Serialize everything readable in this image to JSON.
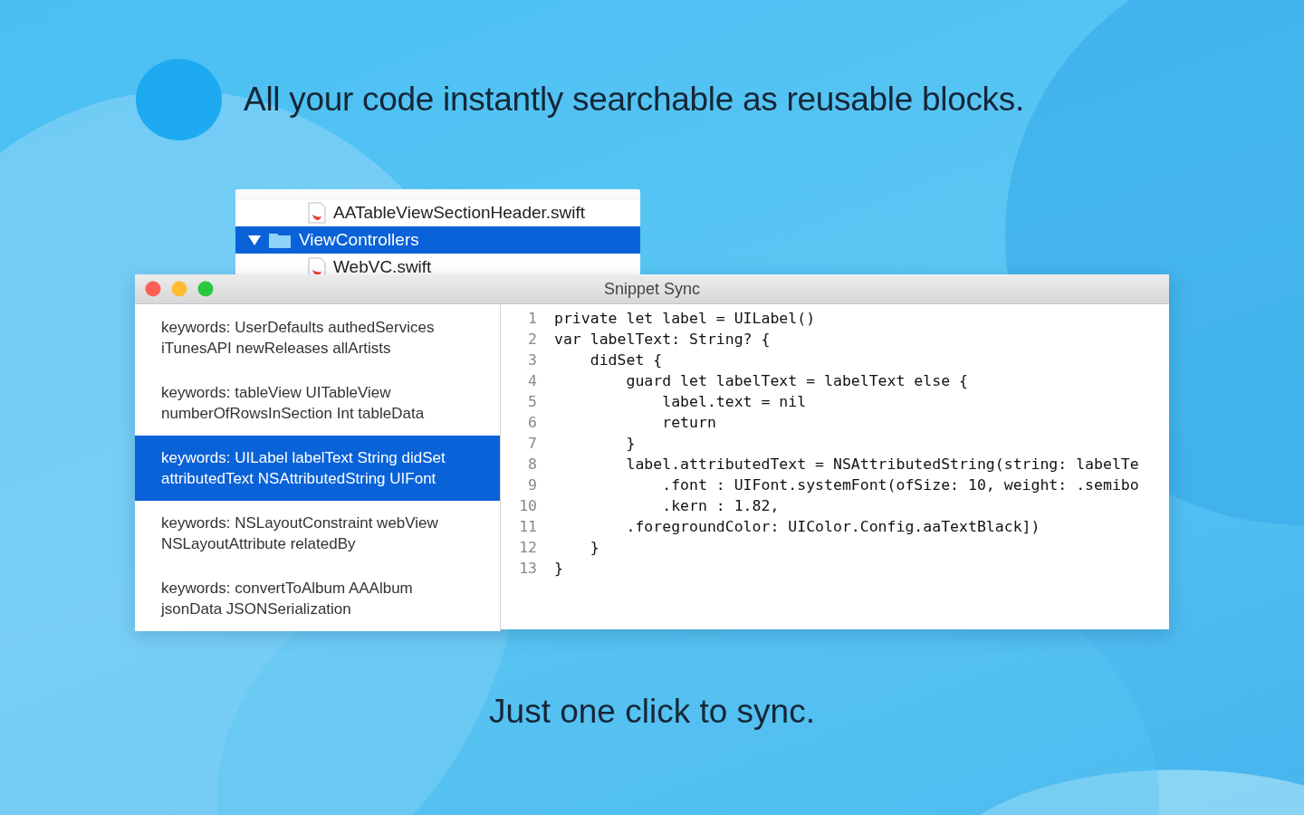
{
  "headline": "All your code instantly searchable as reusable blocks.",
  "file_tree": {
    "rows": [
      {
        "name": "AATableViewSectionHeader.swift",
        "kind": "file",
        "selected": false
      },
      {
        "name": "ViewControllers",
        "kind": "folder",
        "expanded": true,
        "selected": true
      },
      {
        "name": "WebVC.swift",
        "kind": "file",
        "selected": false
      }
    ]
  },
  "window": {
    "title": "Snippet Sync",
    "snippets": [
      {
        "text": "keywords: UserDefaults authedServices\niTunesAPI newReleases allArtists",
        "selected": false
      },
      {
        "text": "keywords: tableView UITableView\nnumberOfRowsInSection Int tableData",
        "selected": false
      },
      {
        "text": "keywords: UILabel labelText String didSet\nattributedText NSAttributedString UIFont",
        "selected": true
      },
      {
        "text": "keywords: NSLayoutConstraint webView\nNSLayoutAttribute relatedBy",
        "selected": false
      },
      {
        "text": "keywords: convertToAlbum AAAlbum\njsonData JSONSerialization",
        "selected": false
      }
    ],
    "code": [
      {
        "number": "1",
        "text": "private let label = UILabel()"
      },
      {
        "number": "2",
        "text": "var labelText: String? {"
      },
      {
        "number": "3",
        "text": "    didSet {"
      },
      {
        "number": "4",
        "text": "        guard let labelText = labelText else {"
      },
      {
        "number": "5",
        "text": "            label.text = nil"
      },
      {
        "number": "6",
        "text": "            return"
      },
      {
        "number": "7",
        "text": "        }"
      },
      {
        "number": "8",
        "text": "        label.attributedText = NSAttributedString(string: labelTe"
      },
      {
        "number": "9",
        "text": "            .font : UIFont.systemFont(ofSize: 10, weight: .semibo"
      },
      {
        "number": "10",
        "text": "            .kern : 1.82,"
      },
      {
        "number": "11",
        "text": "        .foregroundColor: UIColor.Config.aaTextBlack])"
      },
      {
        "number": "12",
        "text": "    }"
      },
      {
        "number": "13",
        "text": "}"
      }
    ]
  },
  "tagline": "Just one click to sync."
}
